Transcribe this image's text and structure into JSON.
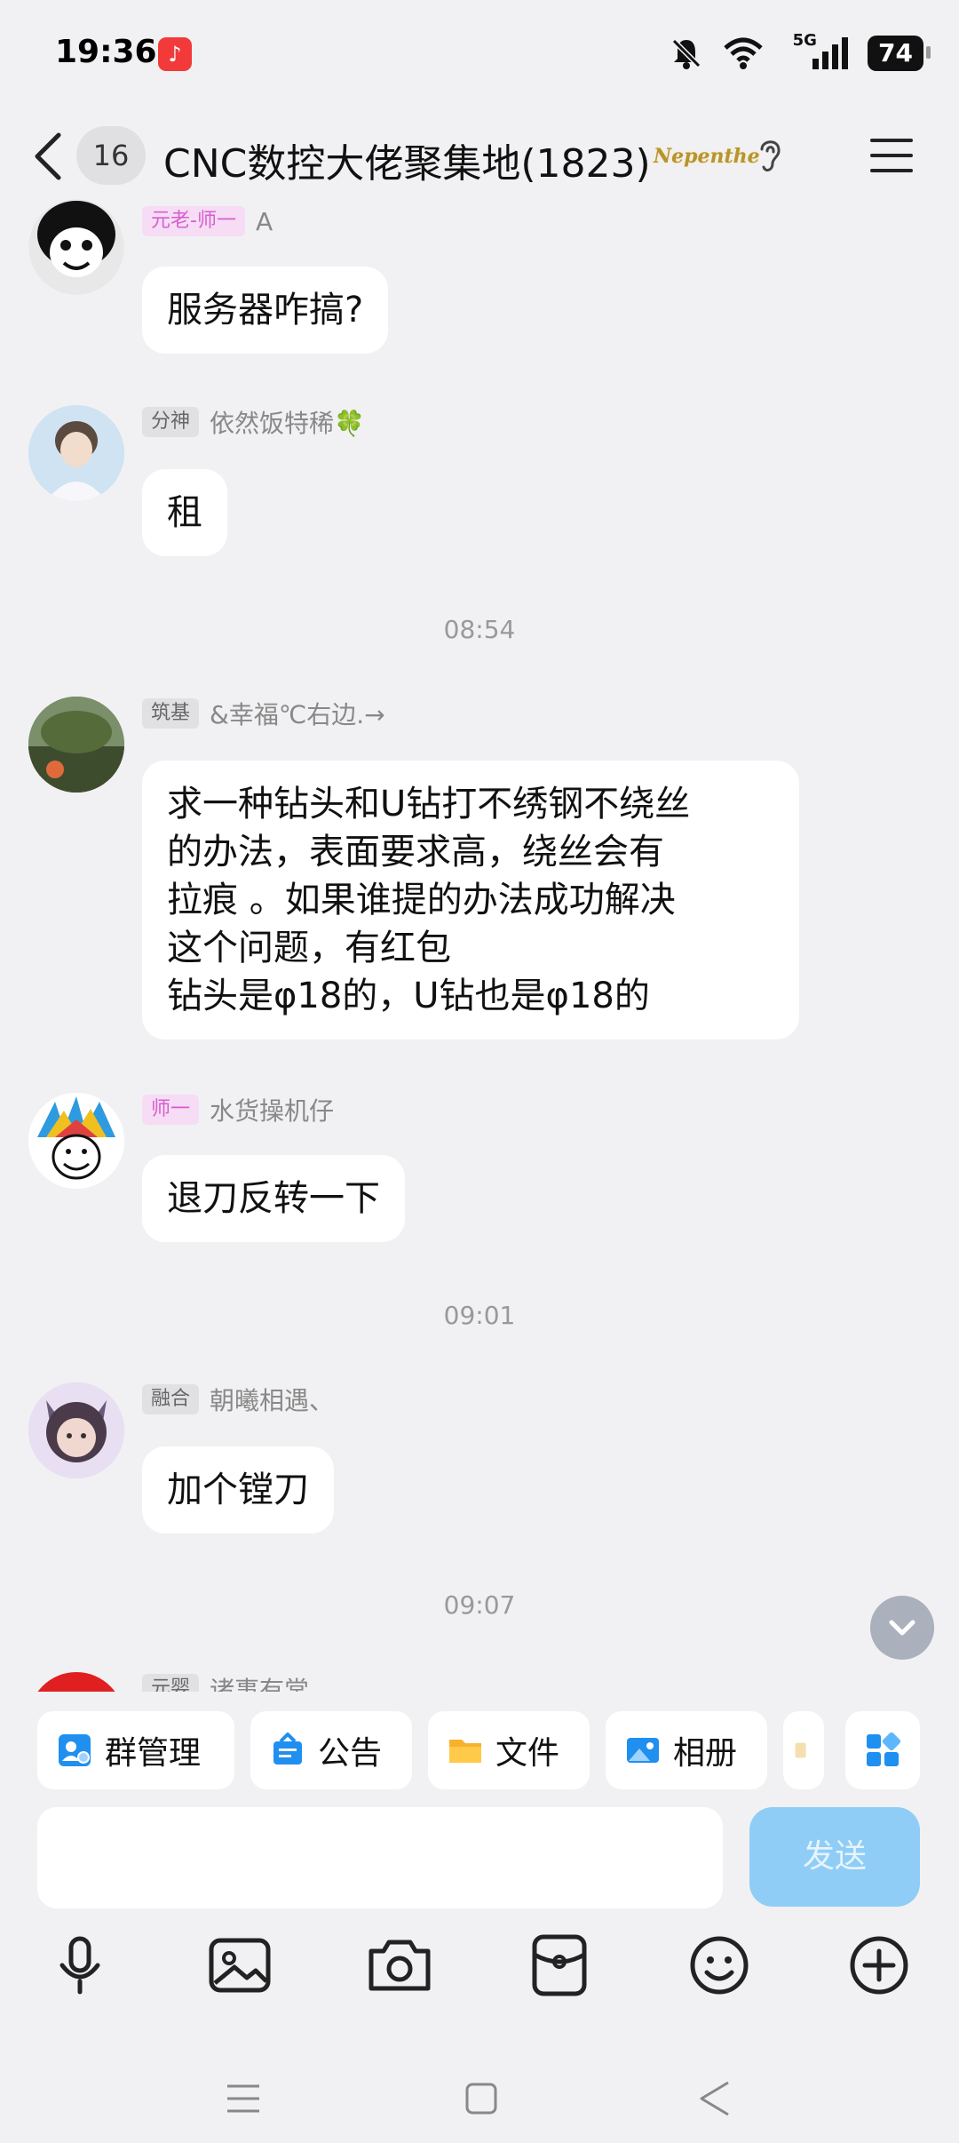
{
  "status_bar": {
    "time": "19:36",
    "network": "5G",
    "battery": "74"
  },
  "header": {
    "unread_count": "16",
    "title": "CNC数控大佬聚集地(1823)",
    "badge_text": "Nepenthe"
  },
  "messages": [
    {
      "type": "message",
      "tag": "元老-师一",
      "name": "A",
      "lines": [
        "服务器咋搞?"
      ]
    },
    {
      "type": "message",
      "tag": "分神",
      "name": "依然饭特稀🍀",
      "lines": [
        "租"
      ]
    },
    {
      "type": "time",
      "text": "08:54"
    },
    {
      "type": "message",
      "tag": "筑基",
      "name": "&幸福℃右边.→",
      "lines": [
        "求一种钻头和U钻打不绣钢不绕丝",
        "的办法，表面要求高，绕丝会有",
        "拉痕 。如果谁提的办法成功解决",
        "这个问题，有红包",
        "钻头是φ18的，U钻也是φ18的"
      ]
    },
    {
      "type": "message",
      "tag": "师一",
      "name": "水货操机仔",
      "lines": [
        "退刀反转一下"
      ]
    },
    {
      "type": "time",
      "text": "09:01"
    },
    {
      "type": "message",
      "tag": "融合",
      "name": "朝曦相遇、",
      "lines": [
        "加个镗刀"
      ]
    },
    {
      "type": "time",
      "text": "09:07"
    },
    {
      "type": "message",
      "tag": "元婴",
      "name": "诸事有常",
      "lines": []
    }
  ],
  "quick_actions": [
    {
      "label": "群管理",
      "icon": "group-manage-icon"
    },
    {
      "label": "公告",
      "icon": "announcement-icon"
    },
    {
      "label": "文件",
      "icon": "folder-icon"
    },
    {
      "label": "相册",
      "icon": "album-icon"
    }
  ],
  "composer": {
    "send_label": "发送",
    "input_value": ""
  },
  "toolbar_icons": [
    "microphone-icon",
    "image-icon",
    "camera-icon",
    "red-packet-icon",
    "emoji-icon",
    "plus-icon"
  ],
  "colors": {
    "background": "#f1f1f3",
    "bubble": "#ffffff",
    "send_button": "#8fcdf6",
    "tag_pink": "#f6dcf4",
    "accent_blue": "#1f8ff0"
  }
}
